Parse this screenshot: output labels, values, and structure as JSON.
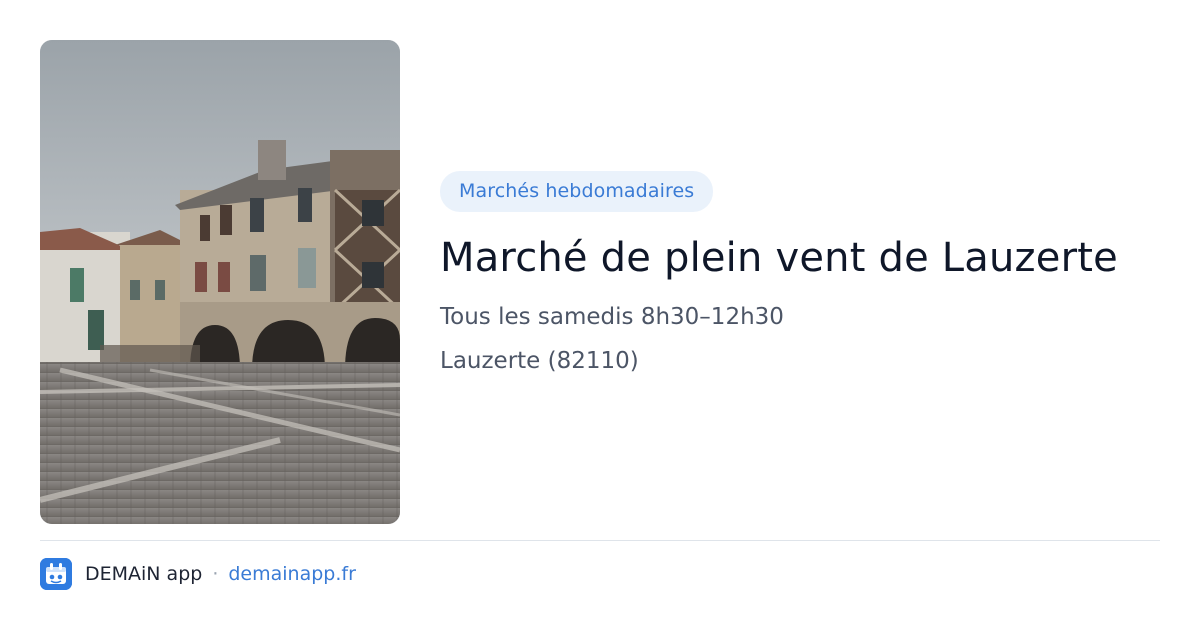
{
  "badge": {
    "label": "Marchés hebdomadaires"
  },
  "event": {
    "title": "Marché de plein vent de Lauzerte",
    "schedule": "Tous les samedis 8h30–12h30",
    "location": "Lauzerte (82110)"
  },
  "footer": {
    "brand": "DEMAiN app",
    "separator": "·",
    "website": "demainapp.fr"
  },
  "colors": {
    "accent": "#3a7bd5",
    "badge_bg": "#eaf2fb",
    "title": "#0f1729",
    "meta": "#4c5566",
    "logo_bg": "#2f7be0"
  },
  "icons": {
    "logo": "demain-app-logo-icon"
  }
}
